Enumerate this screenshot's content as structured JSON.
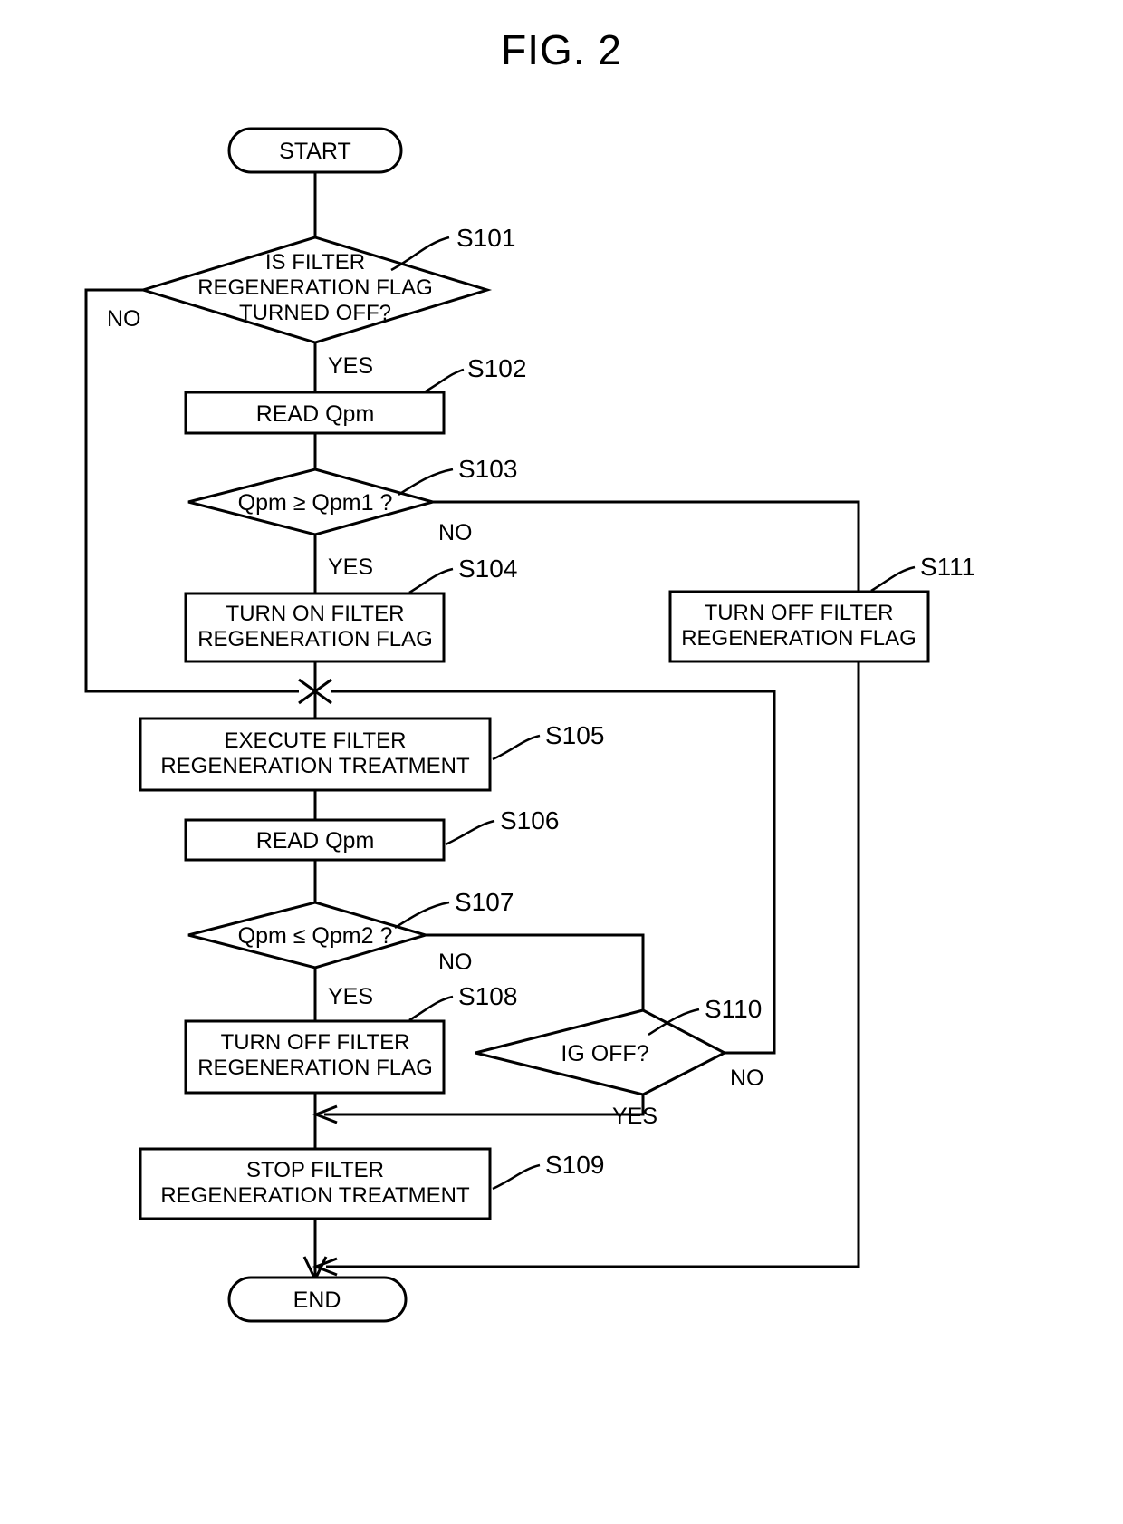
{
  "figure": {
    "title": "FIG. 2"
  },
  "nodes": {
    "start": {
      "label": "START",
      "shape": "terminal"
    },
    "s101": {
      "step": "S101",
      "shape": "decision",
      "lines": [
        "IS FILTER",
        "REGENERATION FLAG",
        "TURNED OFF?"
      ]
    },
    "s102": {
      "step": "S102",
      "shape": "process",
      "lines": [
        "READ Qpm"
      ]
    },
    "s103": {
      "step": "S103",
      "shape": "decision",
      "lines": [
        "Qpm ≥ Qpm1 ?"
      ]
    },
    "s104": {
      "step": "S104",
      "shape": "process",
      "lines": [
        "TURN ON FILTER",
        "REGENERATION FLAG"
      ]
    },
    "s105": {
      "step": "S105",
      "shape": "process",
      "lines": [
        "EXECUTE FILTER",
        "REGENERATION TREATMENT"
      ]
    },
    "s106": {
      "step": "S106",
      "shape": "process",
      "lines": [
        "READ Qpm"
      ]
    },
    "s107": {
      "step": "S107",
      "shape": "decision",
      "lines": [
        "Qpm ≤ Qpm2 ?"
      ]
    },
    "s108": {
      "step": "S108",
      "shape": "process",
      "lines": [
        "TURN OFF FILTER",
        "REGENERATION FLAG"
      ]
    },
    "s109": {
      "step": "S109",
      "shape": "process",
      "lines": [
        "STOP FILTER",
        "REGENERATION TREATMENT"
      ]
    },
    "s110": {
      "step": "S110",
      "shape": "decision",
      "lines": [
        "IG OFF?"
      ]
    },
    "s111": {
      "step": "S111",
      "shape": "process",
      "lines": [
        "TURN OFF FILTER",
        "REGENERATION FLAG"
      ]
    },
    "end": {
      "label": "END",
      "shape": "terminal"
    }
  },
  "edge_labels": {
    "s101_no": "NO",
    "s101_yes": "YES",
    "s103_no": "NO",
    "s103_yes": "YES",
    "s107_no": "NO",
    "s107_yes": "YES",
    "s110_no": "NO",
    "s110_yes": "YES"
  },
  "colors": {
    "stroke": "#000000",
    "background": "#ffffff",
    "text": "#000000"
  }
}
